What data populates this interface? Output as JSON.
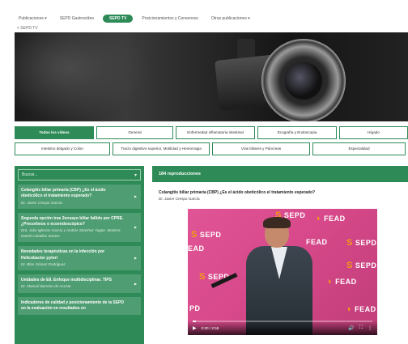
{
  "nav": {
    "items": [
      {
        "label": "Publicaciones ▾",
        "active": false
      },
      {
        "label": "SEPD Gastrovídeo",
        "active": false
      },
      {
        "label": "SEPD TV",
        "active": true
      },
      {
        "label": "Posicionamientos y Consensos",
        "active": false
      },
      {
        "label": "Otras publicaciones ▾",
        "active": false
      }
    ]
  },
  "breadcrumb": "< SEPD TV",
  "filters": {
    "row1": [
      {
        "label": "Todos los vídeos",
        "active": true
      },
      {
        "label": "General",
        "active": false
      },
      {
        "label": "Enfermedad inflamatoria intestinal",
        "active": false
      },
      {
        "label": "Ecografía y Endoscopia",
        "active": false
      },
      {
        "label": "Hígado",
        "active": false
      }
    ],
    "row2": [
      {
        "label": "Intestino delgado y Colon",
        "active": false
      },
      {
        "label": "Tracto digestivo superior, Motilidad y Hemorragia",
        "active": false
      },
      {
        "label": "Vías biliares y Páncreas",
        "active": false
      },
      {
        "label": "Especialidad",
        "active": false
      }
    ]
  },
  "sidebar": {
    "search_placeholder": "Buscar...",
    "videos": [
      {
        "title": "Colangitis biliar primaria (CBP) ¿Es el ácido obeticólico el tratamiento esperado?",
        "author": "Dr. Javier Crespo García"
      },
      {
        "title": "Segunda opción tras 2ensayo biliar fallido por CPRE. ¿Precorbeos o ecoendoscópico?",
        "author": "Dra. Julio Iglesias García y Andrés Sánchez Yagüe. Modera: Daniel Ceballos Santos"
      },
      {
        "title": "Novedades terapéuticas en la infección por Helicobacter pylori",
        "author": "Dr. Blas Gómez Rodríguez"
      },
      {
        "title": "Unidades de EII. Enfoque multidisciplinar. TIPS",
        "author": "Dr. Manuel Barreiro de Acosta"
      },
      {
        "title": "Indicadores de calidad y posicionamiento de la SEPD en la evaluación en resultados en",
        "author": ""
      }
    ]
  },
  "main": {
    "counter": "184 reproducciones",
    "video_title": "Colangitis biliar primaria (CBP) ¿Es el ácido obeticólico el tratamiento esperado?",
    "video_author": "Dr. Javier Crespo García",
    "player": {
      "time": "0:00 / 2:58",
      "progress_fraction": 0.02,
      "logos": [
        "SEPD",
        "FEAD",
        "SEPD",
        "FEAD",
        "SEPD",
        "SEPD",
        "FEAD",
        "EAD",
        "PD",
        "FEAD",
        "SEPD"
      ],
      "logo_caption": "SEPD"
    }
  },
  "colors": {
    "brand_green": "#2e8b57",
    "player_pink": "#d94a8a",
    "logo_orange": "#f39c12"
  },
  "icons": {
    "play": "play-icon",
    "volume": "volume-icon",
    "fullscreen": "fullscreen-icon",
    "more": "more-icon",
    "chevron": "chevron-right-icon"
  }
}
